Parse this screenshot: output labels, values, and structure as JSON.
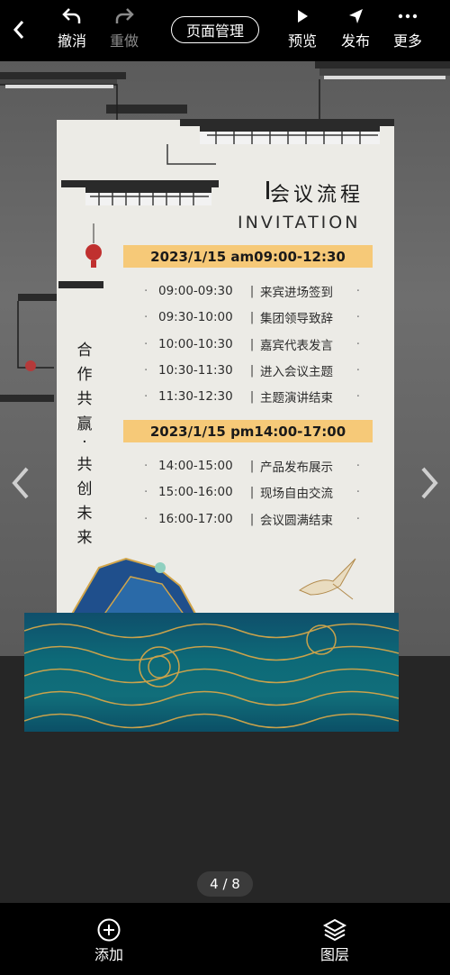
{
  "toolbar": {
    "undo_label": "撤消",
    "redo_label": "重做",
    "page_manage_label": "页面管理",
    "preview_label": "预览",
    "publish_label": "发布",
    "more_label": "更多"
  },
  "card": {
    "title_cn": "会议流程",
    "title_en": "INVITATION",
    "vertical_text": [
      "合",
      "作",
      "共",
      "赢",
      "·",
      "共",
      "创",
      "未",
      "来"
    ],
    "sessions": [
      {
        "date": "2023/1/15 am09:00-12:30",
        "items": [
          {
            "time": "09:00-09:30",
            "name": "来宾进场签到"
          },
          {
            "time": "09:30-10:00",
            "name": "集团领导致辞"
          },
          {
            "time": "10:00-10:30",
            "name": "嘉宾代表发言"
          },
          {
            "time": "10:30-11:30",
            "name": "进入会议主题"
          },
          {
            "time": "11:30-12:30",
            "name": "主题演讲结束"
          }
        ]
      },
      {
        "date": "2023/1/15 pm14:00-17:00",
        "items": [
          {
            "time": "14:00-15:00",
            "name": "产品发布展示"
          },
          {
            "time": "15:00-16:00",
            "name": "现场自由交流"
          },
          {
            "time": "16:00-17:00",
            "name": "会议圆满结束"
          }
        ]
      }
    ]
  },
  "pager": {
    "text": "4 / 8"
  },
  "bottom": {
    "add_label": "添加",
    "layers_label": "图层"
  },
  "icons": {
    "back": "chevron-left-icon",
    "undo": "undo-icon",
    "redo": "redo-icon",
    "preview": "play-icon",
    "publish": "send-icon",
    "more": "more-dots-icon",
    "add": "plus-circle-icon",
    "layers": "layers-icon",
    "prev": "chevron-left-icon",
    "next": "chevron-right-icon"
  },
  "colors": {
    "band": "#f6c978",
    "card": "#ecebe6",
    "wave": "#0d6a78"
  }
}
